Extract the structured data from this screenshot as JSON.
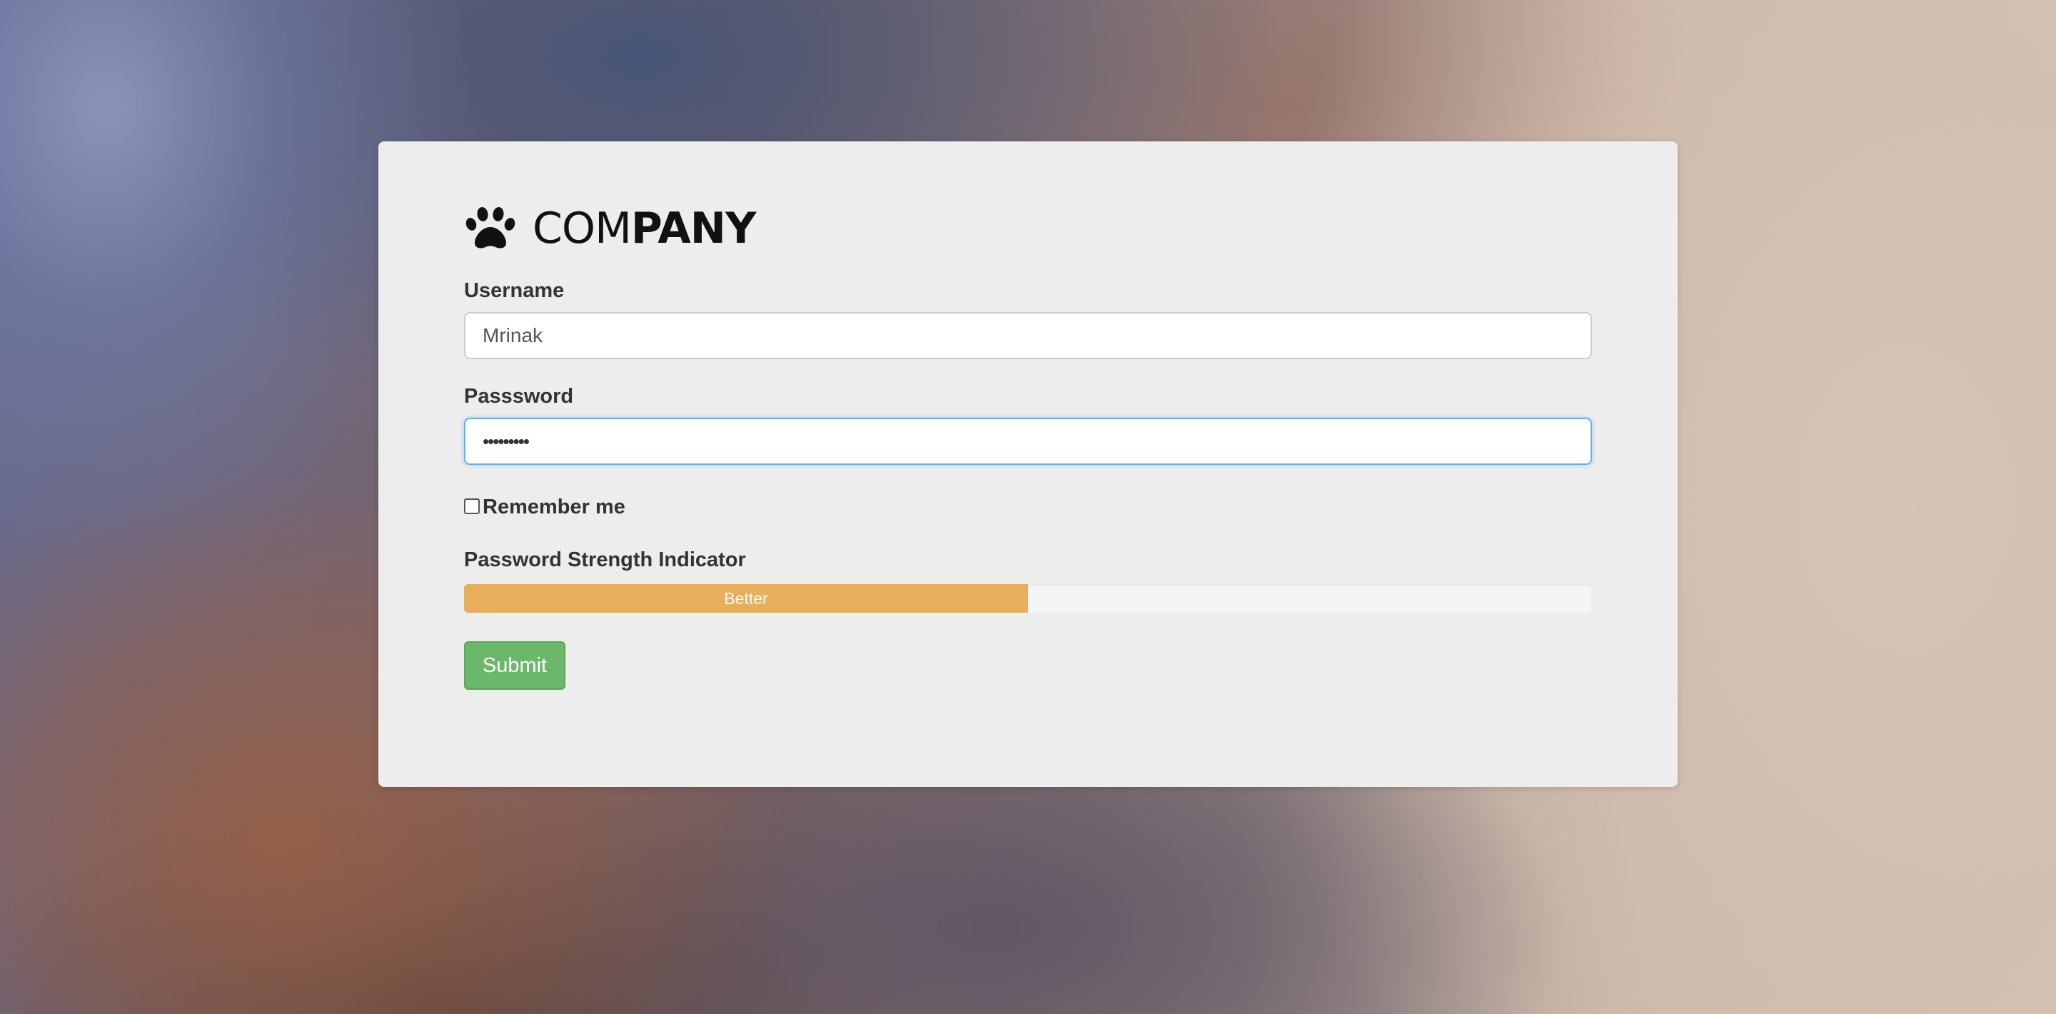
{
  "brand": {
    "logo_icon": "paw-icon",
    "name_part_light": "COM",
    "name_part_bold": "PANY"
  },
  "form": {
    "username_label": "Username",
    "username_value": "Mrinak",
    "password_label": "Passsword",
    "password_value": "•••••••••",
    "remember_label": "Remember me",
    "remember_checked": false,
    "strength_label": "Password Strength Indicator",
    "strength_text": "Better",
    "strength_percent": 50,
    "strength_color": "#e8ae5c",
    "submit_label": "Submit",
    "submit_color": "#6cb86a",
    "focus_color": "#66afe9"
  }
}
